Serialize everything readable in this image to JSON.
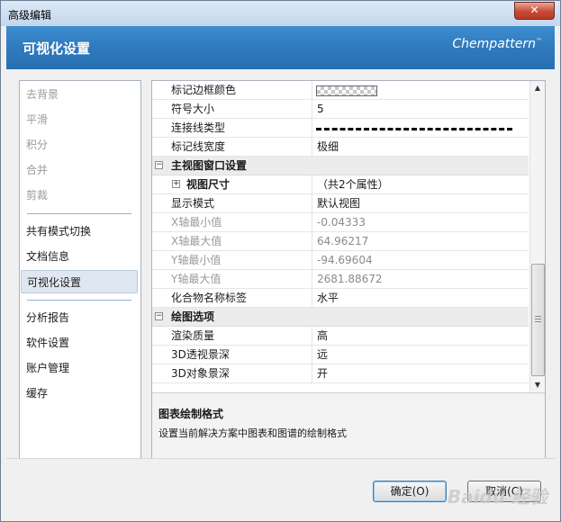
{
  "window": {
    "title": "高级编辑",
    "close_glyph": "✕"
  },
  "header": {
    "title": "可视化设置",
    "brand": "Chempattern",
    "brand_mark": "™"
  },
  "sidebar": {
    "group1": [
      "去背景",
      "平滑",
      "积分",
      "合并",
      "剪裁"
    ],
    "group2": [
      "共有模式切换",
      "文档信息",
      "可视化设置"
    ],
    "group3": [
      "分析报告",
      "软件设置",
      "账户管理",
      "缓存"
    ],
    "active": "可视化设置"
  },
  "grid": {
    "rows": [
      {
        "type": "prop",
        "key": "标记边框颜色",
        "value": "",
        "value_kind": "swatch"
      },
      {
        "type": "prop",
        "key": "符号大小",
        "value": "5"
      },
      {
        "type": "prop",
        "key": "连接线类型",
        "value": "",
        "value_kind": "dashline"
      },
      {
        "type": "prop",
        "key": "标记线宽度",
        "value": "极细"
      },
      {
        "type": "cat",
        "key": "主视图窗口设置",
        "toggle": "−"
      },
      {
        "type": "sub",
        "key": "视图尺寸",
        "value": "（共2个属性）",
        "toggle": "+"
      },
      {
        "type": "prop",
        "key": "显示模式",
        "value": "默认视图"
      },
      {
        "type": "prop",
        "key": "X轴最小值",
        "value": "-0.04333",
        "dim": true
      },
      {
        "type": "prop",
        "key": "X轴最大值",
        "value": "64.96217",
        "dim": true
      },
      {
        "type": "prop",
        "key": "Y轴最小值",
        "value": "-94.69604",
        "dim": true
      },
      {
        "type": "prop",
        "key": "Y轴最大值",
        "value": "2681.88672",
        "dim": true
      },
      {
        "type": "prop",
        "key": "化合物名称标签",
        "value": "水平"
      },
      {
        "type": "cat",
        "key": "绘图选项",
        "toggle": "−"
      },
      {
        "type": "prop",
        "key": "渲染质量",
        "value": "高"
      },
      {
        "type": "prop",
        "key": "3D透视景深",
        "value": "远"
      },
      {
        "type": "prop",
        "key": "3D对象景深",
        "value": "开"
      }
    ],
    "scroll_up": "▲",
    "scroll_down": "▼"
  },
  "description": {
    "title": "图表绘制格式",
    "text": "设置当前解决方案中图表和图谱的绘制格式"
  },
  "footer": {
    "ok_label": "确定(O)",
    "cancel_label": "取消(C)",
    "watermark": "Baidu 经验"
  }
}
